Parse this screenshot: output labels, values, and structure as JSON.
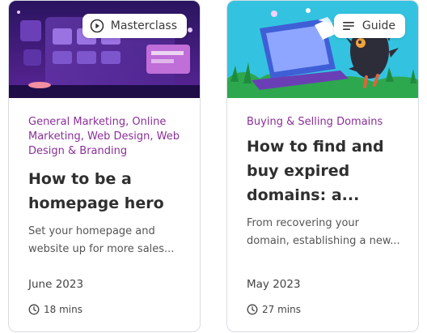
{
  "cards": [
    {
      "badge": {
        "label": "Masterclass",
        "icon": "play-circle-icon"
      },
      "categories": "General Marketing, Online Marketing, Web Design, Web Design & Branding",
      "title": "How to be a homepage hero",
      "description": "Set your homepage and website up for more sales...",
      "date": "June 2023",
      "read_time": "18 mins"
    },
    {
      "badge": {
        "label": "Guide",
        "icon": "list-lines-icon"
      },
      "categories": "Buying & Selling Domains",
      "title": "How to find and buy expired domains: a...",
      "description": "From recovering your domain, establishing a new...",
      "date": "May 2023",
      "read_time": "27 mins"
    }
  ],
  "colors": {
    "category": "#8b2f99",
    "title": "#2f2f2f",
    "masterclass_bg": "#3a1a6e",
    "guide_bg": "#33c3e0"
  }
}
